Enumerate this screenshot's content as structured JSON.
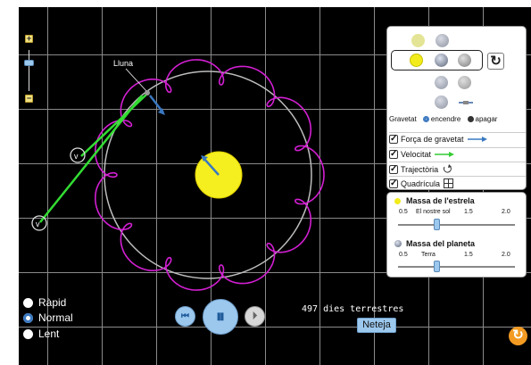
{
  "scene": {
    "moon_label": "Lluna"
  },
  "zoom": {
    "plus": "+",
    "minus": "−"
  },
  "panel": {
    "body_icons": [
      "sun-small-icon",
      "planet-small-icon",
      "sun-icon",
      "planet-icon",
      "moon-icon",
      "planet-icon-2",
      "moon-icon-2",
      "planet-icon-3",
      "satellite-icon"
    ],
    "reset_symbol": "↻",
    "gravity_label": "Gravetat",
    "gravity_on": "encendre",
    "gravity_off": "apagar",
    "gravity_state": "on",
    "checks": [
      {
        "label": "Força de gravetat",
        "checked": true,
        "indicator": "blue-arrow"
      },
      {
        "label": "Velocitat",
        "checked": true,
        "indicator": "green-arrow"
      },
      {
        "label": "Trajectòria",
        "checked": true,
        "indicator": "path-icon"
      },
      {
        "label": "Quadrícula",
        "checked": true,
        "indicator": "grid-icon"
      }
    ]
  },
  "mass": {
    "star_title": "Massa de l'estrela",
    "star_ticks": [
      "0.5",
      "El nostre sol",
      "1.5",
      "2.0"
    ],
    "star_value": 1.0,
    "planet_title": "Massa del planeta",
    "planet_ticks": [
      "0.5",
      "Terra",
      "1.5",
      "2.0"
    ],
    "planet_value": 1.0
  },
  "speed": {
    "options": [
      "Ràpid",
      "Normal",
      "Lent"
    ],
    "selected": "Normal"
  },
  "playback": {
    "rewind": "⏮",
    "pause": "⏸",
    "step": "⏵"
  },
  "readout": "497 dies terrestres",
  "clear_label": "Neteja",
  "reset_all_symbol": "↻",
  "colors": {
    "background": "#000000",
    "sun": "#f5ef1f",
    "trajectory": "#d21fd2",
    "velocity": "#33dd33",
    "gravity": "#3a78c0"
  }
}
